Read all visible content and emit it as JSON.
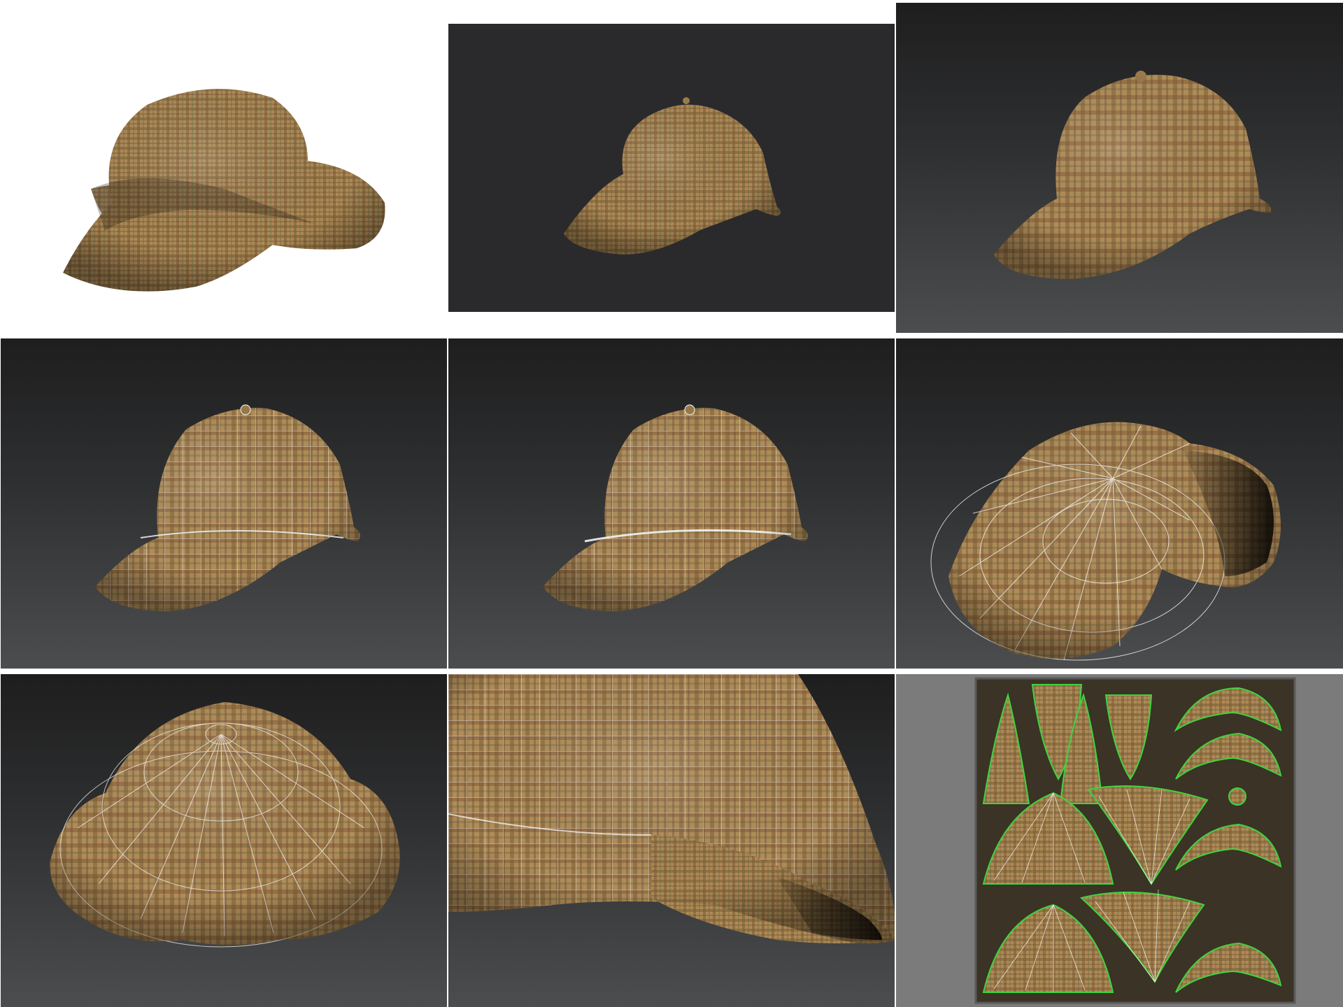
{
  "sheet": {
    "description_free": true,
    "tiles": [
      {
        "id": "render-white",
        "background": "#ffffff"
      },
      {
        "id": "render-flat-dark",
        "background": "#2a2a2c"
      },
      {
        "id": "render-gradient",
        "background": "#3a3b3c"
      },
      {
        "id": "wire-side-left",
        "background": "#3a3b3c"
      },
      {
        "id": "wire-side-right",
        "background": "#3a3b3c"
      },
      {
        "id": "wire-underside",
        "background": "#3a3b3c"
      },
      {
        "id": "wire-top",
        "background": "#3a3b3c"
      },
      {
        "id": "wire-closeup",
        "background": "#3a3b3c"
      },
      {
        "id": "uv-layout",
        "background": "#7b7b7b"
      }
    ]
  },
  "colors": {
    "fabric_base": "#a8844f",
    "fabric_dark": "#6b4e2a",
    "fabric_check": "#7a5a38",
    "wire": "#ffffff",
    "uv_outline": "#3fd43f",
    "uv_bg": "#3b3325"
  }
}
